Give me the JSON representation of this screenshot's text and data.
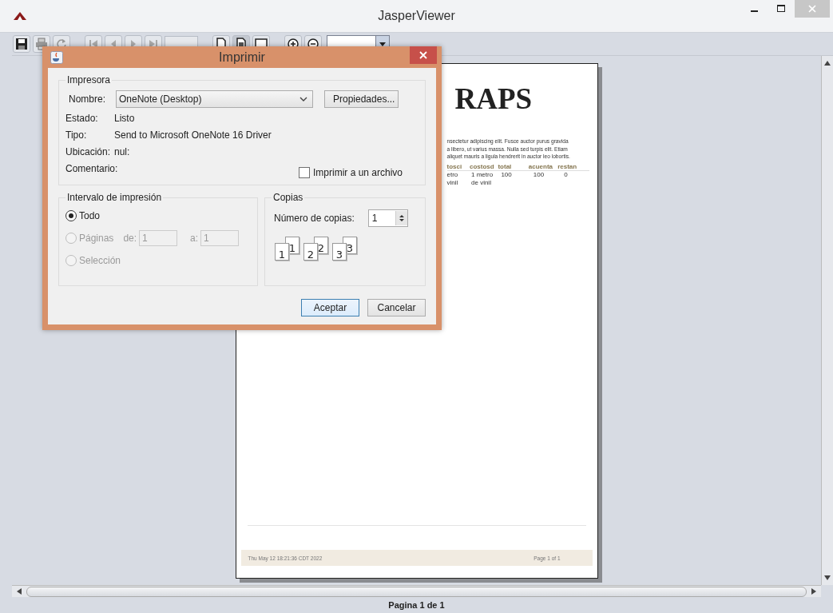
{
  "window": {
    "title": "JasperViewer"
  },
  "report": {
    "title": "RAPS",
    "paragraph_lines": [
      "nsectetur adipiscing elit. Fusce auctor purus gravida",
      "a libero, ut varius massa. Nulla sed turpis elit. Etiam",
      "aliquet mauris a ligula hendrerit in auctor leo lobortis."
    ],
    "columns": [
      "tosci",
      "costosd",
      "total",
      "acuenta",
      "restan"
    ],
    "rows": [
      [
        "etro vinil",
        "1 metro de vinil",
        "100",
        "100",
        "0"
      ]
    ],
    "footer": {
      "date": "Thu May 12 18:21:36 CDT 2022",
      "page": "Page 1 of 1"
    }
  },
  "status_bar": "Pagina 1 de 1",
  "dialog": {
    "title": "Imprimir",
    "printer": {
      "legend": "Impresora",
      "name_label": "Nombre:",
      "name": "OneNote (Desktop)",
      "properties_button": "Propiedades...",
      "fields": [
        {
          "label": "Estado:",
          "value": "Listo"
        },
        {
          "label": "Tipo:",
          "value": "Send to Microsoft OneNote 16 Driver"
        },
        {
          "label": "Ubicación:",
          "value": "nul:"
        },
        {
          "label": "Comentario:"
        }
      ],
      "print_to_file": {
        "label": "Imprimir a un archivo",
        "checked": false
      }
    },
    "range": {
      "legend": "Intervalo de impresión",
      "options": [
        {
          "kind": "all",
          "label": "Todo",
          "selected": true,
          "disabled": false
        },
        {
          "kind": "pages",
          "label": "Páginas",
          "selected": false,
          "disabled": true
        },
        {
          "kind": "selection",
          "label": "Selección",
          "selected": false,
          "disabled": true
        }
      ],
      "from_label": "de:",
      "from": "1",
      "to_label": "a:",
      "to": "1"
    },
    "copies": {
      "legend": "Copias",
      "label": "Número de copias:",
      "value": "1",
      "collate": [
        {
          "back": "1",
          "front": "1"
        },
        {
          "back": "2",
          "front": "2"
        },
        {
          "back": "3",
          "front": "3"
        }
      ]
    },
    "buttons": [
      {
        "label": "Aceptar",
        "default": true
      },
      {
        "label": "Cancelar",
        "default": false
      }
    ]
  }
}
